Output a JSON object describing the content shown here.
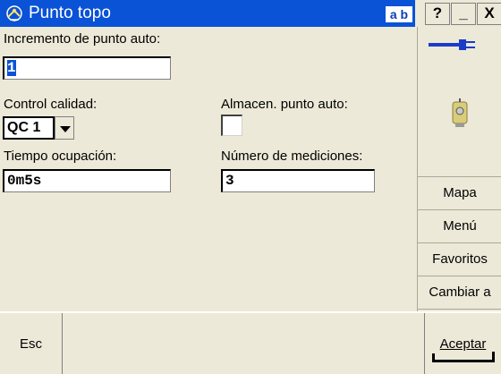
{
  "window": {
    "title": "Punto topo",
    "ab_badge": "a b",
    "help_label": "?",
    "minimize_label": "_",
    "close_label": "X"
  },
  "form": {
    "increment_label": "Incremento de punto auto:",
    "increment_value": "1",
    "quality_label": "Control calidad:",
    "quality_value": "QC 1",
    "auto_store_label": "Almacen. punto auto:",
    "auto_store_checked": false,
    "occupation_label": "Tiempo ocupación:",
    "occupation_value": "0m5s",
    "measurements_label": "Número de mediciones:",
    "measurements_value": "3"
  },
  "right_panel": {
    "buttons": [
      "Mapa",
      "Menú",
      "Favoritos",
      "Cambiar a"
    ]
  },
  "bottom": {
    "esc_label": "Esc",
    "accept_label": "Aceptar"
  },
  "colors": {
    "title_blue": "#0a52d6",
    "face": "#ece9d8",
    "cable_blue": "#1a3cc8"
  }
}
